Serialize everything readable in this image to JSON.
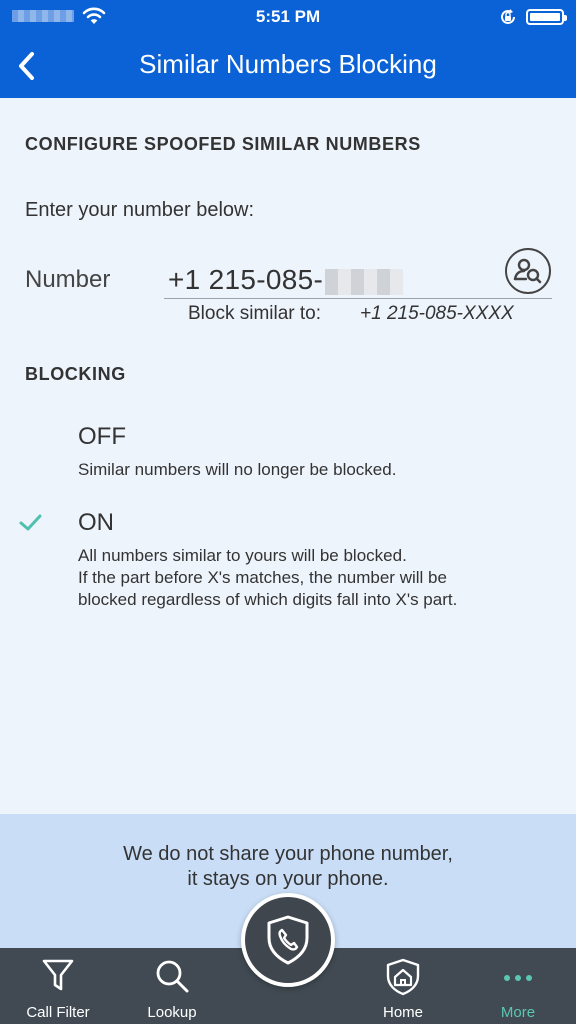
{
  "status_bar": {
    "time": "5:51 PM"
  },
  "nav": {
    "title": "Similar Numbers Blocking"
  },
  "configure": {
    "heading": "CONFIGURE SPOOFED SIMILAR NUMBERS",
    "prompt": "Enter your number below:",
    "number_label": "Number",
    "number_value": "+1 215-085-",
    "block_similar_label": "Block similar to:",
    "block_similar_value": "+1 215-085-XXXX"
  },
  "blocking": {
    "heading": "BLOCKING",
    "options": [
      {
        "title": "OFF",
        "description": "Similar numbers will no longer be blocked.",
        "selected": false
      },
      {
        "title": "ON",
        "description": "All numbers similar to yours will be blocked.\nIf the part before X's matches, the number will be\nblocked regardless of which digits fall into X's part.",
        "selected": true
      }
    ]
  },
  "privacy": {
    "text": "We do not share your phone number,\nit stays on your phone."
  },
  "tabbar": {
    "tabs": [
      {
        "label": "Call Filter",
        "icon": "filter-icon"
      },
      {
        "label": "Lookup",
        "icon": "search-icon"
      },
      {
        "label": "Home",
        "icon": "home-shield-icon"
      },
      {
        "label": "More",
        "icon": "more-dots-icon",
        "active": true
      }
    ],
    "center_icon": "shield-phone-icon"
  },
  "colors": {
    "brand_blue": "#0a62d6",
    "accent_teal": "#5bc7b2",
    "tabbar_bg": "#414a52"
  }
}
